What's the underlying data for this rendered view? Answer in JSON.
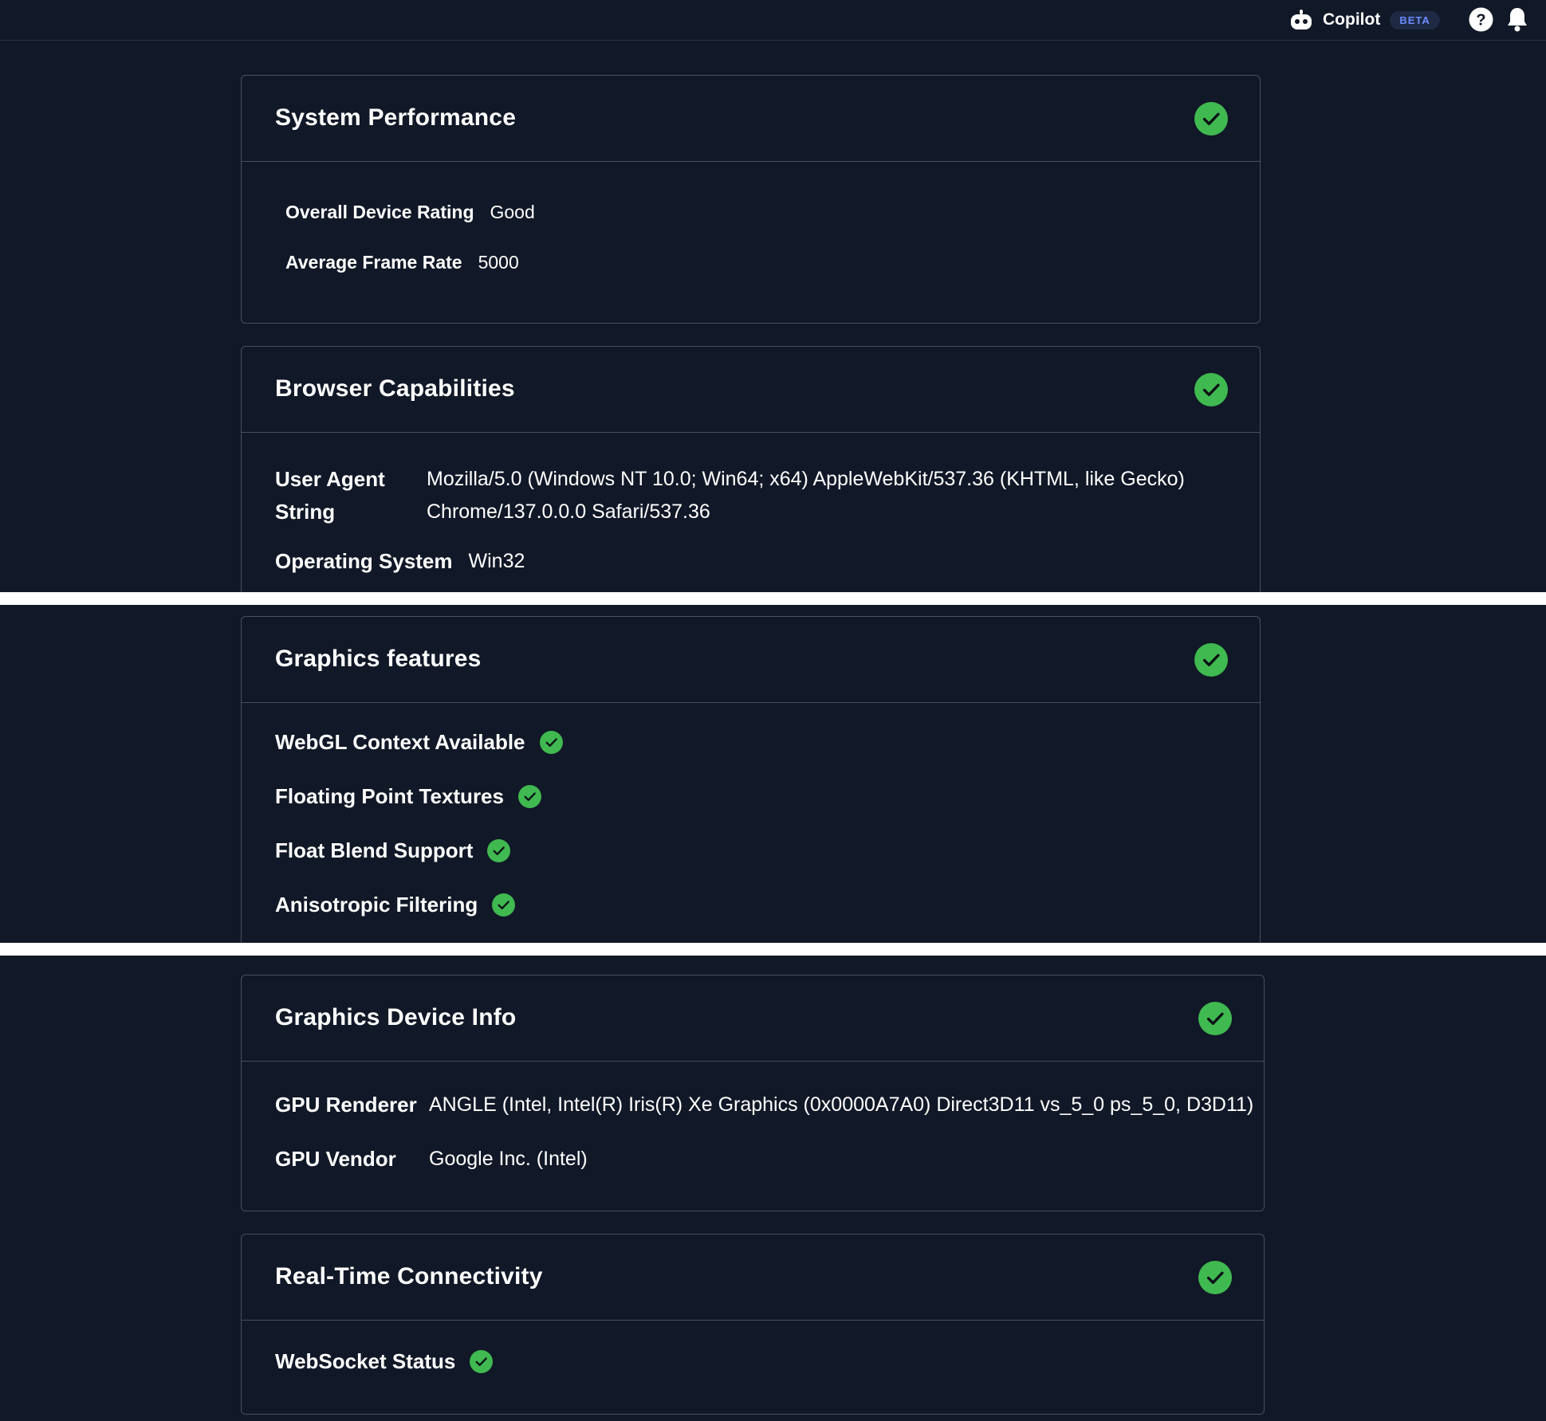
{
  "header": {
    "copilot_label": "Copilot",
    "beta_badge": "BETA",
    "icons": [
      "copilot-bot-icon",
      "help-icon",
      "bell-icon"
    ]
  },
  "colors": {
    "accent_ok": "#3fb950",
    "good_text": "#17a34a",
    "badge_text": "#6b8cff",
    "background": "#111827"
  },
  "system_performance": {
    "title": "System Performance",
    "status": "ok",
    "rating_label": "Overall Device Rating",
    "rating_value": "Good",
    "frame_rate_label": "Average Frame Rate",
    "frame_rate_value": "5000"
  },
  "browser_capabilities": {
    "title": "Browser Capabilities",
    "status": "ok",
    "ua_label_line1": "User Agent",
    "ua_label_line2": "String",
    "ua_value_line1": "Mozilla/5.0 (Windows NT 10.0; Win64; x64) AppleWebKit/537.36 (KHTML, like Gecko)",
    "ua_value_line2": "Chrome/137.0.0.0 Safari/537.36",
    "os_label": "Operating System",
    "os_value": "Win32"
  },
  "graphics_features": {
    "title": "Graphics features",
    "status": "ok",
    "items": [
      {
        "label": "WebGL Context Available",
        "status": "ok"
      },
      {
        "label": "Floating Point Textures",
        "status": "ok"
      },
      {
        "label": "Float Blend Support",
        "status": "ok"
      },
      {
        "label": "Anisotropic Filtering",
        "status": "ok"
      }
    ]
  },
  "graphics_device_info": {
    "title": "Graphics Device Info",
    "status": "ok",
    "renderer_label": "GPU Renderer",
    "renderer_value": "ANGLE (Intel, Intel(R) Iris(R) Xe Graphics (0x0000A7A0) Direct3D11 vs_5_0 ps_5_0, D3D11)",
    "vendor_label": "GPU Vendor",
    "vendor_value": "Google Inc. (Intel)"
  },
  "realtime_connectivity": {
    "title": "Real-Time Connectivity",
    "status": "ok",
    "websocket_label": "WebSocket Status",
    "websocket_status": "ok"
  }
}
